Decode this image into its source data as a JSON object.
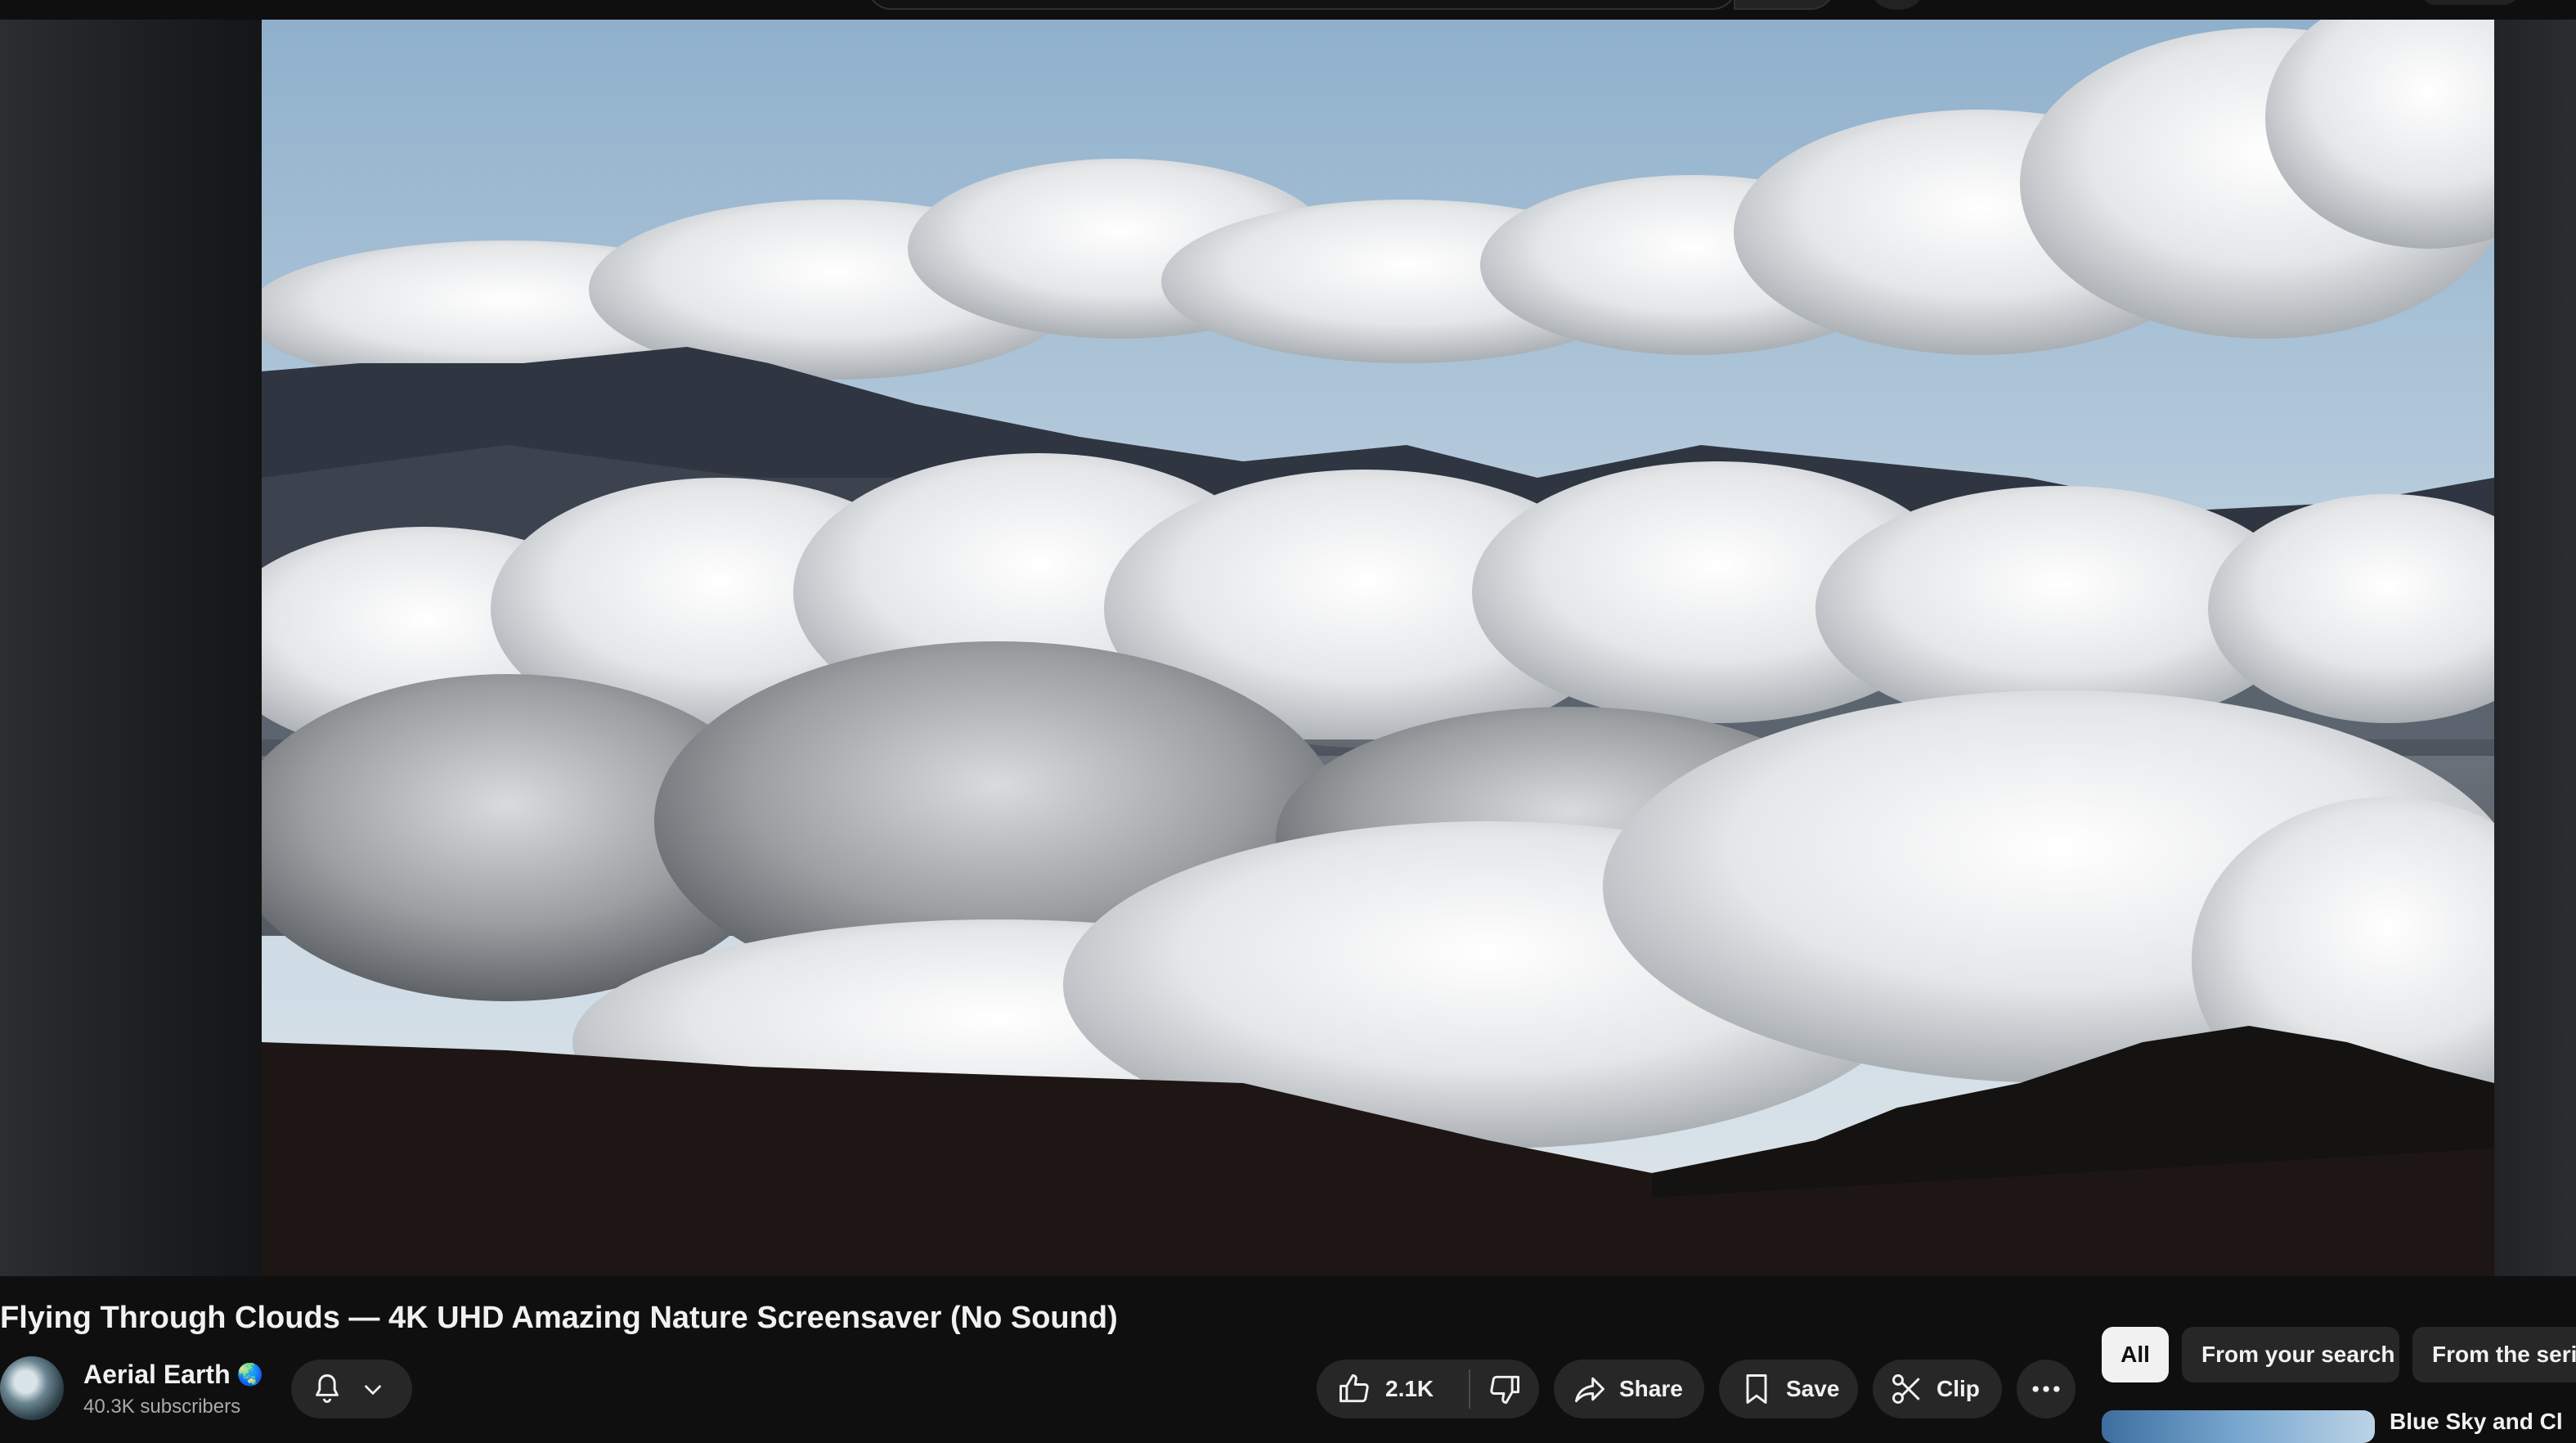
{
  "video": {
    "title": "Flying Through Clouds — 4K UHD Amazing Nature Screensaver (No Sound)"
  },
  "channel": {
    "name": "Aerial Earth",
    "badge": "🌏",
    "subscribers": "40.3K subscribers"
  },
  "actions": {
    "like_count": "2.1K",
    "share_label": "Share",
    "save_label": "Save",
    "clip_label": "Clip"
  },
  "chips": [
    {
      "label": "All",
      "active": true
    },
    {
      "label": "From your search",
      "active": false
    },
    {
      "label": "From the serie",
      "active": false
    }
  ],
  "up_next": {
    "title_partial": "Blue Sky and Cl"
  },
  "colors": {
    "background": "#0f0f0f",
    "surface": "#272727",
    "text": "#f1f1f1",
    "muted": "#aaaaaa"
  }
}
